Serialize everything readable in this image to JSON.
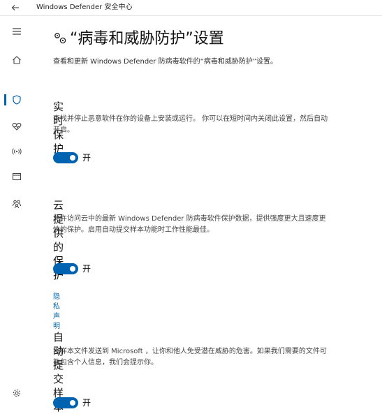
{
  "titlebar": {
    "back_icon": "back-arrow-icon",
    "title": "Windows Defender 安全中心"
  },
  "sidebar": {
    "items": [
      {
        "name": "hamburger-menu",
        "icon": "hamburger-icon"
      },
      {
        "name": "home",
        "icon": "home-icon"
      },
      {
        "name": "virus-protection",
        "icon": "shield-icon",
        "active": true
      },
      {
        "name": "health",
        "icon": "heart-icon"
      },
      {
        "name": "network",
        "icon": "wifi-icon"
      },
      {
        "name": "app-browser",
        "icon": "browser-window-icon"
      },
      {
        "name": "family",
        "icon": "family-icon"
      },
      {
        "name": "settings",
        "icon": "gear-icon"
      }
    ],
    "accent": "#0063b1"
  },
  "main": {
    "heading": "“病毒和威胁防护”设置",
    "description": "查看和更新 Windows Defender 防病毒软件的“病毒和威胁防护”设置。",
    "sections": [
      {
        "title": "实时保护",
        "description": "查找并停止恶意软件在你的设备上安装或运行。 你可以在短时间内关闭此设置，然后自动开启。",
        "toggle_state": "on",
        "toggle_label": "开"
      },
      {
        "title": "云提供的保护",
        "description": "允许访问云中的最新 Windows Defender 防病毒软件保护数据，提供强度更大且速度更快的保护。启用自动提交样本功能时工作性能最佳。",
        "toggle_state": "on",
        "toggle_label": "开",
        "link": "隐私声明"
      },
      {
        "title": "自动提交样本",
        "description": "将样本文件发送到 Microsoft ，让你和他人免受潜在威胁的危害。如果我们需要的文件可能包含个人信息，我们会提示你。",
        "toggle_state": "on",
        "toggle_label": "开"
      }
    ]
  }
}
